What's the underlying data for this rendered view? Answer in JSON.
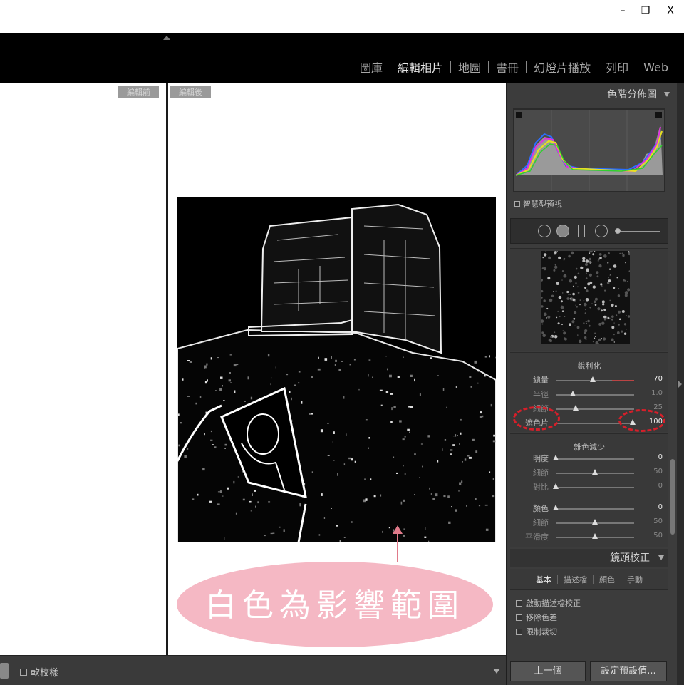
{
  "window": {
    "minimize": "–",
    "restore": "❐",
    "close": "X"
  },
  "modules": [
    {
      "label": "圖庫",
      "active": false
    },
    {
      "label": "編輯相片",
      "active": true
    },
    {
      "label": "地圖",
      "active": false
    },
    {
      "label": "書冊",
      "active": false
    },
    {
      "label": "幻燈片播放",
      "active": false
    },
    {
      "label": "列印",
      "active": false
    },
    {
      "label": "Web",
      "active": false
    }
  ],
  "view": {
    "before_label": "編輯前",
    "after_label": "編輯後"
  },
  "annotation": {
    "text": "白色為影響範圍",
    "color": "#f5b8c4"
  },
  "toolbar": {
    "soft_proof_label": "軟校樣"
  },
  "histogram": {
    "title": "色階分佈圖",
    "smart_preview_label": "智慧型預視"
  },
  "sharpening": {
    "title": "銳利化",
    "rows": [
      {
        "label": "總量",
        "value": "70",
        "fraction": 0.47,
        "dim": false,
        "hot": true
      },
      {
        "label": "半徑",
        "value": "1.0",
        "fraction": 0.22,
        "dim": true,
        "hot": false
      },
      {
        "label": "細節",
        "value": "25",
        "fraction": 0.25,
        "dim": true,
        "hot": false
      },
      {
        "label": "遮色片",
        "value": "100",
        "fraction": 0.98,
        "dim": false,
        "hot": false
      }
    ]
  },
  "noise_reduction": {
    "title": "雜色減少",
    "rows": [
      {
        "label": "明度",
        "value": "0",
        "fraction": 0.0,
        "dim": false
      },
      {
        "label": "細節",
        "value": "50",
        "fraction": 0.5,
        "dim": true
      },
      {
        "label": "對比",
        "value": "0",
        "fraction": 0.0,
        "dim": true
      },
      {
        "label": "顏色",
        "value": "0",
        "fraction": 0.0,
        "dim": false
      },
      {
        "label": "細節",
        "value": "50",
        "fraction": 0.5,
        "dim": true
      },
      {
        "label": "平滑度",
        "value": "50",
        "fraction": 0.5,
        "dim": true
      }
    ]
  },
  "lens": {
    "title": "鏡頭校正",
    "tabs": [
      {
        "label": "基本",
        "active": true
      },
      {
        "label": "描述檔",
        "active": false
      },
      {
        "label": "顏色",
        "active": false
      },
      {
        "label": "手動",
        "active": false
      }
    ],
    "options": [
      "啟動描述檔校正",
      "移除色差",
      "限制裁切"
    ]
  },
  "nav": {
    "previous_label": "上一個",
    "preset_label": "設定預設值..."
  },
  "colors": {
    "highlight_ring": "#d61f2a",
    "annotation_arrow": "#e07a8a"
  }
}
